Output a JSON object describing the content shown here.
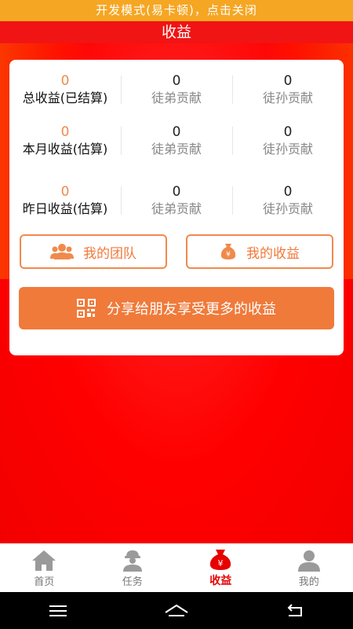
{
  "banner": {
    "text": "开发模式(易卡顿)，点击关闭"
  },
  "header": {
    "title": "收益"
  },
  "stats": [
    {
      "value": "0",
      "label": "总收益(已结算)",
      "c1_value": "0",
      "c1_label": "徒弟贡献",
      "c2_value": "0",
      "c2_label": "徒孙贡献"
    },
    {
      "value": "0",
      "label": "本月收益(估算)",
      "c1_value": "0",
      "c1_label": "徒弟贡献",
      "c2_value": "0",
      "c2_label": "徒孙贡献"
    },
    {
      "value": "0",
      "label": "昨日收益(估算)",
      "c1_value": "0",
      "c1_label": "徒弟贡献",
      "c2_value": "0",
      "c2_label": "徒孙贡献"
    }
  ],
  "buttons": {
    "team": "我的团队",
    "income": "我的收益",
    "share": "分享给朋友享受更多的收益"
  },
  "tabs": [
    {
      "label": "首页",
      "icon": "home-icon"
    },
    {
      "label": "任务",
      "icon": "worker-icon"
    },
    {
      "label": "收益",
      "icon": "money-bag-icon",
      "badge": "¥"
    },
    {
      "label": "我的",
      "icon": "user-icon"
    }
  ],
  "colors": {
    "accent": "#f07a3a",
    "background": "#ff0000",
    "banner": "#f5a623",
    "active_tab": "#e60000"
  }
}
